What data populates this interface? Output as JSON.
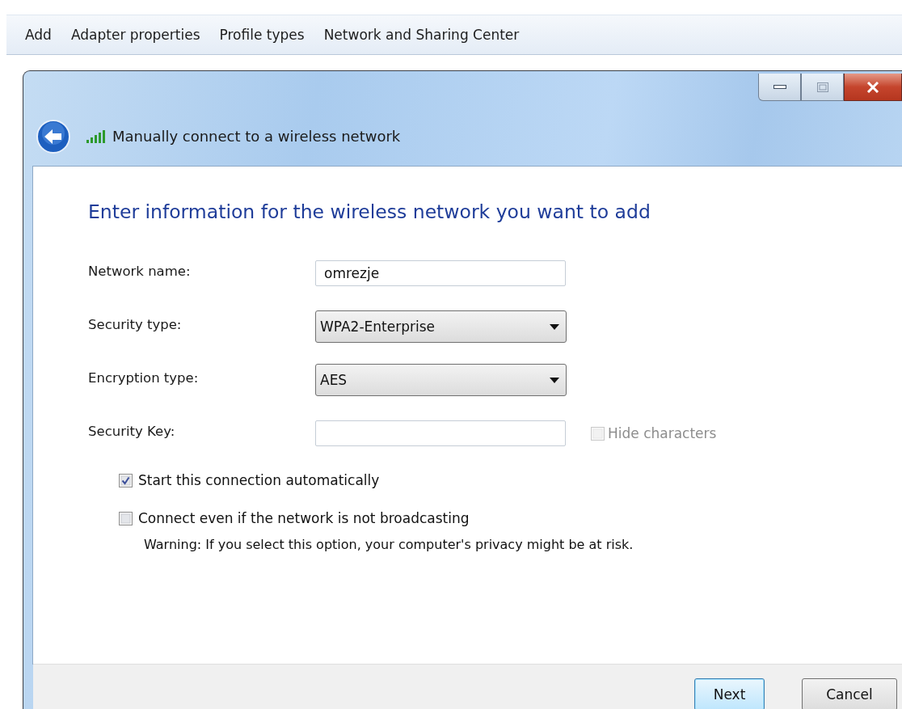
{
  "toolbar": {
    "items": [
      {
        "label": "Add"
      },
      {
        "label": "Adapter properties"
      },
      {
        "label": "Profile types"
      },
      {
        "label": "Network and Sharing Center"
      }
    ]
  },
  "window": {
    "title": "Manually connect to a wireless network"
  },
  "heading": "Enter information for the wireless network you want to add",
  "fields": [
    {
      "kind": "text",
      "label": "Network name:",
      "value": "omrezje"
    },
    {
      "kind": "select",
      "label": "Security type:",
      "value": "WPA2-Enterprise"
    },
    {
      "kind": "select",
      "label": "Encryption type:",
      "value": "AES"
    },
    {
      "kind": "text",
      "label": "Security Key:",
      "side_checkbox": {
        "label": "Hide characters",
        "checked": false,
        "disabled": true
      }
    }
  ],
  "options": [
    {
      "label": "Start this connection automatically",
      "checked": true
    },
    {
      "label": "Connect even if the network is not broadcasting",
      "checked": false,
      "note": "Warning: If you select this option, your computer's privacy might be at risk."
    }
  ],
  "buttons": [
    {
      "label": "Next",
      "default": true
    },
    {
      "label": "Cancel",
      "default": false
    }
  ]
}
